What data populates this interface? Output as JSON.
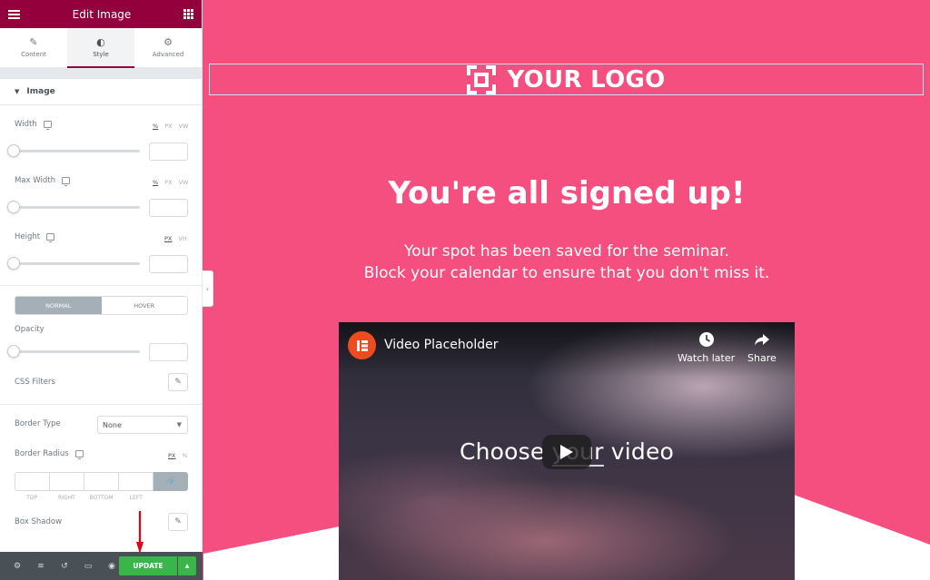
{
  "panel": {
    "title": "Edit Image",
    "tabs": [
      {
        "label": "Content",
        "icon": "pencil-icon"
      },
      {
        "label": "Style",
        "icon": "half-circle-icon"
      },
      {
        "label": "Advanced",
        "icon": "gear-icon"
      }
    ],
    "section_title": "Image",
    "width": {
      "label": "Width",
      "units": [
        "%",
        "PX",
        "VW"
      ],
      "value": ""
    },
    "max_width": {
      "label": "Max Width",
      "units": [
        "%",
        "PX",
        "VW"
      ],
      "value": ""
    },
    "height": {
      "label": "Height",
      "units": [
        "PX",
        "VH"
      ],
      "value": ""
    },
    "state_toggle": {
      "normal": "NORMAL",
      "hover": "HOVER"
    },
    "opacity": {
      "label": "Opacity",
      "value": ""
    },
    "css_filters": {
      "label": "CSS Filters"
    },
    "border_type": {
      "label": "Border Type",
      "value": "None"
    },
    "border_radius": {
      "label": "Border Radius",
      "units": [
        "PX",
        "%"
      ],
      "sides": [
        "TOP",
        "RIGHT",
        "BOTTOM",
        "LEFT"
      ]
    },
    "box_shadow": {
      "label": "Box Shadow"
    },
    "footer": {
      "update_label": "UPDATE"
    }
  },
  "preview": {
    "logo_text": "YOUR LOGO",
    "headline": "You're all signed up!",
    "line1": "Your spot has been saved for the seminar.",
    "line2": "Block your calendar to ensure that you don't miss it.",
    "video": {
      "title": "Video Placeholder",
      "watch_later": "Watch later",
      "share": "Share",
      "overlay_a": "Choose ",
      "overlay_b": "your",
      "overlay_c": " video"
    }
  },
  "colors": {
    "panel_header": "#93003c",
    "page_background": "#f44f7e",
    "update_button": "#39b54a",
    "footer_bar": "#495157",
    "youtube_channel": "#f04a1f"
  }
}
